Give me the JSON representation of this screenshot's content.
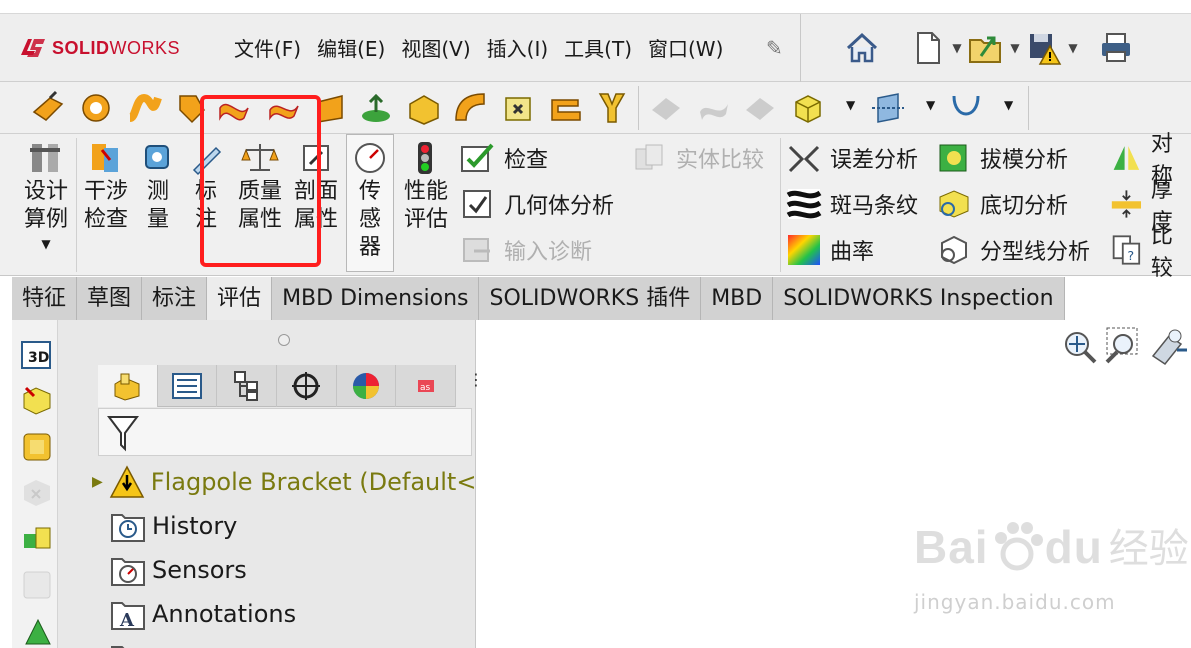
{
  "app": {
    "brand_prefix": "SOLID",
    "brand_suffix": "WORKS"
  },
  "menu": {
    "items": [
      "文件(F)",
      "编辑(E)",
      "视图(V)",
      "插入(I)",
      "工具(T)",
      "窗口(W)"
    ]
  },
  "command_manager": {
    "design_study": [
      "设计",
      "算例"
    ],
    "interference": [
      "干涉",
      "检查"
    ],
    "measure": [
      "测",
      "量"
    ],
    "markup": [
      "标",
      "注"
    ],
    "mass_props": [
      "质量",
      "属性"
    ],
    "section_props": [
      "剖面",
      "属性"
    ],
    "sensor": [
      "传",
      "感",
      "器"
    ],
    "performance": [
      "性能",
      "评估"
    ],
    "check": "检查",
    "geometry_analysis": "几何体分析",
    "import_diagnostics": "输入诊断",
    "compare_bodies": "实体比较",
    "deviation_analysis": "误差分析",
    "zebra_stripes": "斑马条纹",
    "curvature": "曲率",
    "draft_analysis": "拔模分析",
    "undercut_analysis": "底切分析",
    "parting_line_analysis": "分型线分析",
    "symmetry_check": "对称",
    "thickness_analysis": "厚度",
    "compare_docs": "比较"
  },
  "tabs": [
    {
      "label": "特征",
      "active": false
    },
    {
      "label": "草图",
      "active": false
    },
    {
      "label": "标注",
      "active": false
    },
    {
      "label": "评估",
      "active": true
    },
    {
      "label": "MBD Dimensions",
      "active": false
    },
    {
      "label": "SOLIDWORKS 插件",
      "active": false
    },
    {
      "label": "MBD",
      "active": false
    },
    {
      "label": "SOLIDWORKS Inspection",
      "active": false
    }
  ],
  "tree": {
    "root": "Flagpole Bracket  (Default<<",
    "items": [
      "History",
      "Sensors",
      "Annotations"
    ]
  },
  "left_strip": {
    "label_3d": "3D"
  },
  "watermark": {
    "text": "Bai",
    "text2": "du",
    "cn": "经验",
    "url": "jingyan.baidu.com"
  },
  "colors": {
    "accent_red": "#ff1e1e",
    "brand_red": "#c8102e",
    "tree_root": "#7a7a10"
  }
}
